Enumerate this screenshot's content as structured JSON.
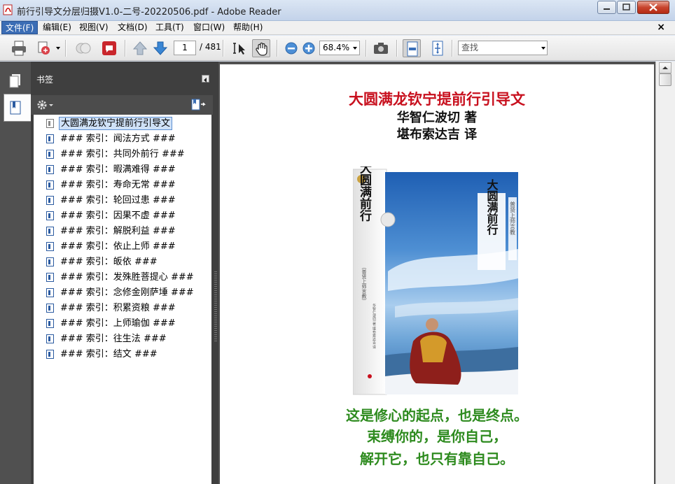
{
  "window": {
    "title": "前行引导文分层归摄V1.0-二号-20220506.pdf - Adobe Reader"
  },
  "menu": {
    "items": [
      "文件(F)",
      "编辑(E)",
      "视图(V)",
      "文档(D)",
      "工具(T)",
      "窗口(W)",
      "帮助(H)"
    ],
    "active_index": 0,
    "close_glyph": "×"
  },
  "toolbar": {
    "page_current": "1",
    "page_total": "/ 481",
    "zoom": "68.4%",
    "search_placeholder": "查找",
    "icons": [
      "print-icon",
      "create-pdf-icon",
      "share-icon",
      "comment-icon",
      "previous-page-icon",
      "next-page-icon",
      "select-tool-icon",
      "hand-tool-icon",
      "zoom-out-icon",
      "zoom-in-icon",
      "snapshot-icon",
      "scroll-mode-icon",
      "fit-page-icon"
    ]
  },
  "nav": {
    "panel_title": "书签",
    "bookmarks": [
      "大圆满龙钦宁提前行引导文",
      "### 索引：闻法方式 ###",
      "### 索引：共同外前行 ###",
      "### 索引：暇满难得 ###",
      "### 索引：寿命无常 ###",
      "### 索引：轮回过患 ###",
      "### 索引：因果不虚 ###",
      "### 索引：解脱利益 ###",
      "### 索引：依止上师 ###",
      "### 索引：皈依 ###",
      "### 索引：发殊胜菩提心 ###",
      "### 索引：念修金刚萨埵 ###",
      "### 索引：积累资粮 ###",
      "### 索引：上师瑜伽 ###",
      "### 索引：往生法 ###",
      "### 索引：结文 ###"
    ],
    "selected_index": 0
  },
  "document": {
    "title": "大圆满龙钦宁提前行引导文",
    "author": "华智仁波切 著",
    "translator": "堪布索达吉 译",
    "cover": {
      "title_main": "大圆满前行",
      "title_right": "大圆满前行",
      "series": "普贤上师言教",
      "subtitle": "（普贤上师言教）",
      "spine_text": "华智仁波切 著  堪布索达吉 译"
    },
    "quote_lines": [
      "这是修心的起点，也是终点。",
      "束缚你的，是你自己，",
      "解开它，也只有靠自己。"
    ],
    "colors": {
      "title_red": "#c8101e",
      "quote_green": "#2e8b1f"
    }
  }
}
